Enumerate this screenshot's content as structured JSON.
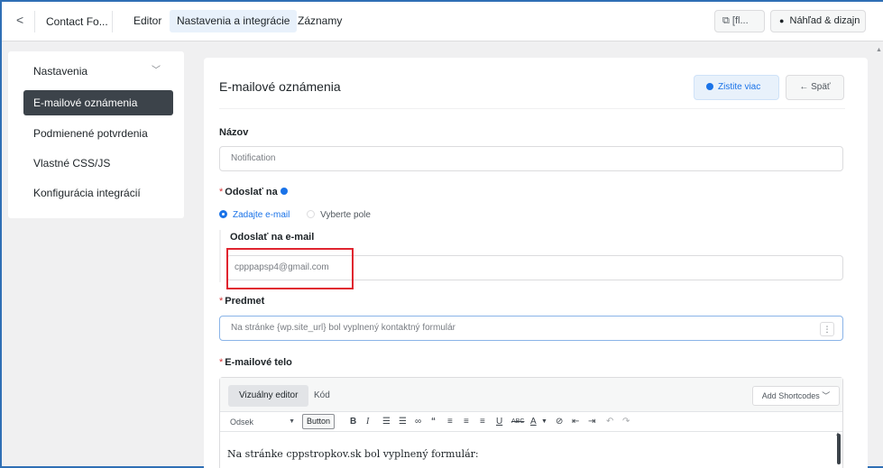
{
  "topbar": {
    "back": "<",
    "form_name": "Contact Fo...",
    "tabs": [
      "Editor",
      "Nastavenia a integrácie",
      "Záznamy"
    ],
    "shortcode": "[fl...",
    "preview": "Náhľad & dizajn"
  },
  "sidebar": {
    "items": [
      {
        "label": "Nastavenia"
      },
      {
        "label": "E-mailové oznámenia"
      },
      {
        "label": "Podmienené potvrdenia"
      },
      {
        "label": "Vlastné CSS/JS"
      },
      {
        "label": "Konfigurácia integrácií"
      }
    ]
  },
  "main": {
    "title": "E-mailové oznámenia",
    "learn_more": "Zistite viac",
    "back": "← Späť",
    "name_label": "Názov",
    "name_value": "Notification",
    "send_to_label": "Odoslať na",
    "radio_options": [
      "Zadajte e-mail",
      "Vyberte pole"
    ],
    "send_to_email_label": "Odoslať na e-mail",
    "send_to_email_value": "cpppapsp4@gmail.com",
    "subject_label": "Predmet",
    "subject_value": "Na stránke {wp.site_url} bol vyplnený kontaktný formulár",
    "body_label": "E-mailové telo"
  },
  "editor": {
    "tab_visual": "Vizuálny editor",
    "tab_code": "Kód",
    "add_shortcodes": "Add Shortcodes",
    "format_select": "Odsek",
    "button_label": "Button",
    "body_text": "Na stránke cppstropkov.sk bol vyplnený formulár:"
  },
  "colors": {
    "accent": "#1a73e8",
    "active_sidebar": "#3c434a",
    "highlight": "#e0242f",
    "required": "#d63638"
  },
  "icons": {
    "toolbar": [
      "bold-icon",
      "italic-icon",
      "bullet-list-icon",
      "numbered-list-icon",
      "link-icon",
      "quote-icon",
      "align-left-icon",
      "align-center-icon",
      "align-right-icon",
      "underline-icon",
      "strikethrough-icon",
      "text-color-icon",
      "clear-format-icon",
      "outdent-icon",
      "indent-icon",
      "undo-icon",
      "redo-icon"
    ]
  }
}
